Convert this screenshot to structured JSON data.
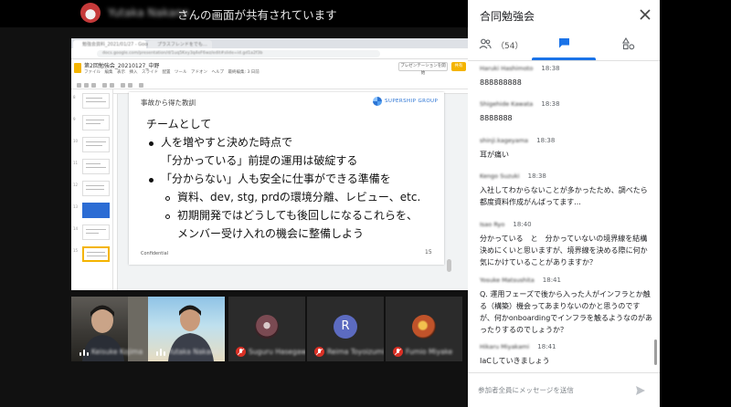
{
  "banner": {
    "presenter_name": "Yutaka Nakano",
    "suffix": "さんの画面が共有されています"
  },
  "shared_screen": {
    "tab1": "勉強会資料_2021/01/27 - Google",
    "tab2": "プラスフレンドをでも…",
    "url": "docs.google.com/presentation/d/1uq5Kxy3q4eF6wz/edit#slide=id.gd1a2f3b",
    "doc_title": "第2回勉強会_20210127_中野",
    "doc_menus": "ファイル　編集　表示　挿入　スライド　配置　ツール　アドオン　ヘルプ　最終編集: 3 日前",
    "present_label": "プレゼンテーションを開始",
    "share_label": "共有",
    "thumb_numbers": [
      "8",
      "9",
      "10",
      "11",
      "12",
      "13",
      "14",
      "15"
    ],
    "slide": {
      "heading": "事故から得た教訓",
      "logo_text": "SUPERSHIP GROUP",
      "lines": [
        "チームとして",
        "人を増やすと決めた時点で",
        "「分かっている」前提の運用は破綻する",
        "「分からない」人も安全に仕事ができる準備を",
        "資料、dev, stg, prdの環境分離、レビュー、etc.",
        "初期開発ではどうしても後回しになるこれらを、",
        "メンバー受け入れの機会に整備しよう"
      ],
      "footer": "Confidential",
      "page": "15"
    }
  },
  "participants": [
    {
      "name": "Keisuke Kojima",
      "kind": "video",
      "mic": "speaking"
    },
    {
      "name": "Yutaka Nakano",
      "kind": "video",
      "mic": "speaking"
    },
    {
      "name": "Suguru Hasegawa",
      "kind": "avatar",
      "mic": "muted"
    },
    {
      "name": "Reima Toyoizumi",
      "kind": "letter",
      "letter": "R",
      "mic": "muted"
    },
    {
      "name": "Fumio Miyake",
      "kind": "avatar",
      "mic": "muted"
    }
  ],
  "panel": {
    "title": "合同勉強会",
    "people_count": "（54）",
    "messages": [
      {
        "sender": "Haruki Hashimoto",
        "time": "18:38",
        "text": "888888888"
      },
      {
        "sender": "Shigehide Kawata",
        "time": "18:38",
        "text": "8888888"
      },
      {
        "sender": "shinji.kageyama",
        "time": "18:38",
        "text": "耳が痛い"
      },
      {
        "sender": "Kengo Suzuki",
        "time": "18:38",
        "text": "入社してわからないことが多かったため、調べたら都度資料作成がんばってます..."
      },
      {
        "sender": "Isao Ryo",
        "time": "18:40",
        "text": "分かっている　と　分かっていないの境界線を結構決めにくいと思いますが、境界線を決める際に何か気にかけていることがありますか？"
      },
      {
        "sender": "Yosuke Matsushita",
        "time": "18:41",
        "text": "Q. 運用フェーズで後から入った人がインフラとか触る（構築）機会ってあまりないのかと思うのですが、何かonboardingでインフラを触るようなのがあったりするのでしょうか？"
      },
      {
        "sender": "Hikaru Miyakami",
        "time": "18:41",
        "text": "IaCしていきましょう"
      }
    ],
    "composer_placeholder": "参加者全員にメッセージを送信"
  },
  "colors": {
    "accent": "#1a73e8",
    "muted_red": "#d93025",
    "letter_avatar": "#5c6bc0"
  },
  "icons": [
    "people-icon",
    "chat-icon",
    "activity-icon",
    "close-icon",
    "send-icon",
    "mic-off-icon"
  ]
}
